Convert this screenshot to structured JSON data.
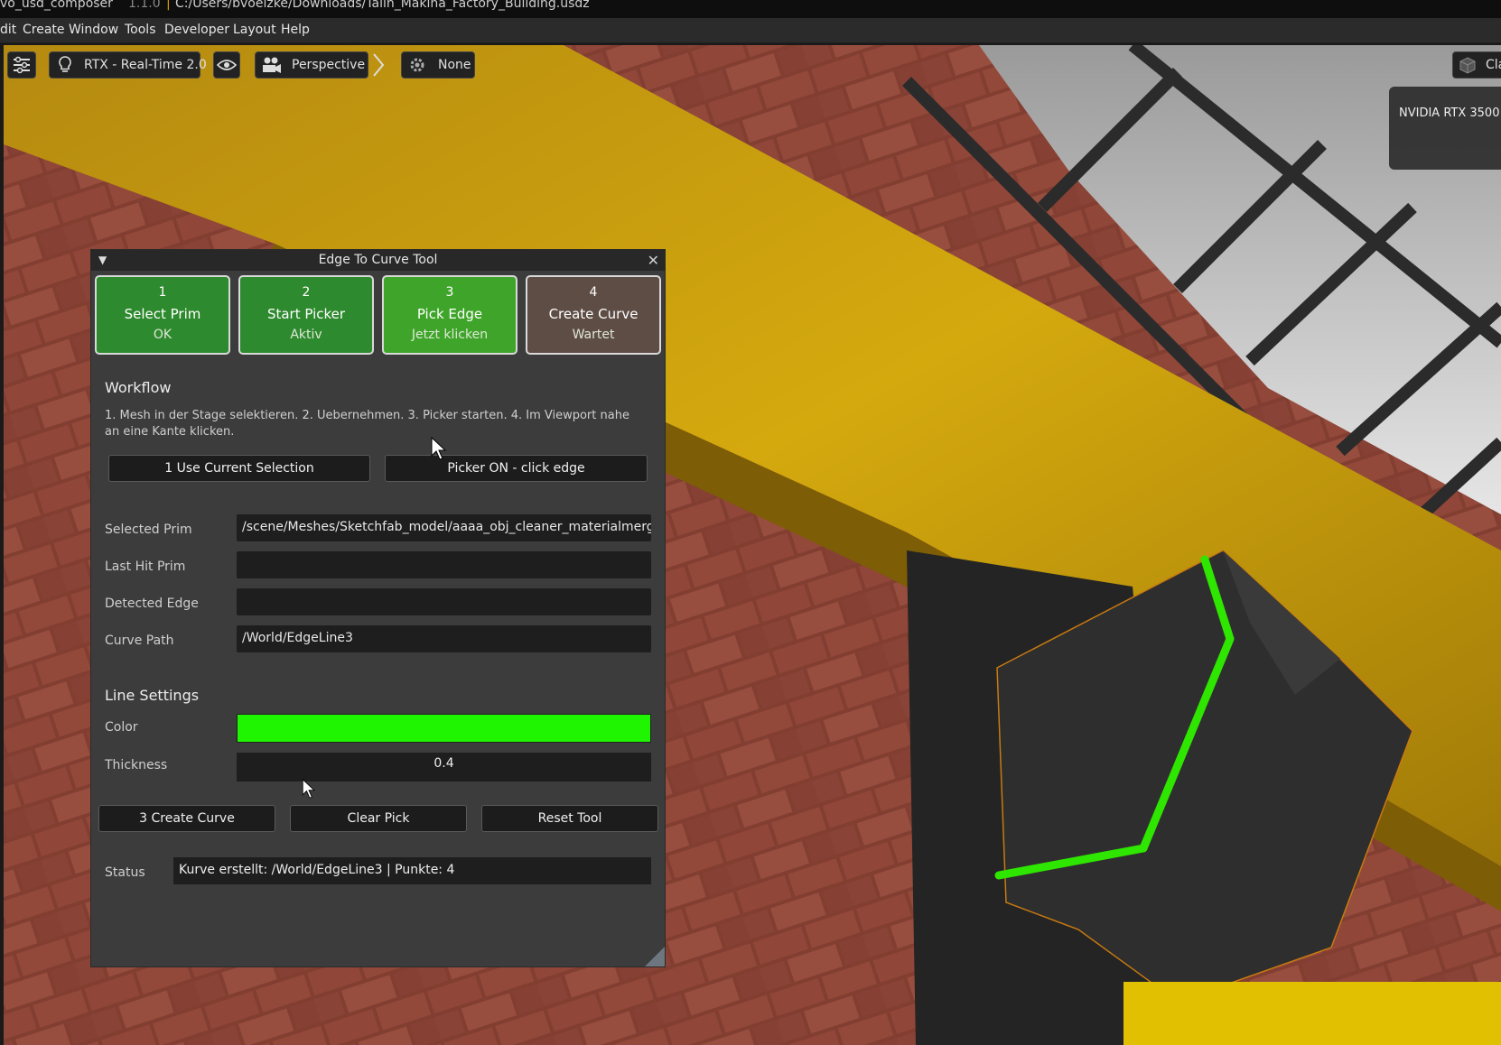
{
  "window_title": {
    "app": "vo_usd_composer",
    "version": "1.1.0",
    "separator": "|",
    "path": "C:/Users/bvoelzke/Downloads/Talin_Makina_Factory_Building.usdz"
  },
  "menu": [
    "dit",
    "Create",
    "Window",
    "Tools",
    "Developer",
    "Layout",
    "Help"
  ],
  "viewport_toolbar": {
    "renderer": "RTX - Real-Time 2.0",
    "camera": "Perspective",
    "settings_value": "None",
    "right_button": "Cla"
  },
  "gpu_label": "NVIDIA RTX 3500",
  "tool": {
    "title": "Edge To Curve Tool",
    "steps": [
      {
        "num": "1",
        "title": "Select Prim",
        "state": "OK",
        "color": "#2e8a2e"
      },
      {
        "num": "2",
        "title": "Start Picker",
        "state": "Aktiv",
        "color": "#2e8a2e"
      },
      {
        "num": "3",
        "title": "Pick Edge",
        "state": "Jetzt klicken",
        "color": "#3fa52a"
      },
      {
        "num": "4",
        "title": "Create Curve",
        "state": "Wartet",
        "color": "#5e4d45"
      }
    ],
    "workflow_heading": "Workflow",
    "workflow_text": "1. Mesh in der Stage selektieren. 2. Uebernehmen. 3. Picker starten. 4. Im Viewport nahe an eine Kante klicken.",
    "use_selection_button": "1  Use Current Selection",
    "picker_button": "Picker ON - click edge",
    "fields": {
      "selected_prim_label": "Selected Prim",
      "selected_prim_value": "/scene/Meshes/Sketchfab_model/aaaa_obj_cleaner_materialmerger_g",
      "last_hit_label": "Last Hit Prim",
      "last_hit_value": "",
      "detected_edge_label": "Detected Edge",
      "detected_edge_value": "",
      "curve_path_label": "Curve Path",
      "curve_path_value": "/World/EdgeLine3"
    },
    "line_settings_heading": "Line Settings",
    "color_label": "Color",
    "color_value": "#1ff500",
    "thickness_label": "Thickness",
    "thickness_value": "0.4",
    "create_curve_button": "3  Create Curve",
    "clear_pick_button": "Clear Pick",
    "reset_tool_button": "Reset Tool",
    "status_label": "Status",
    "status_value": "Kurve erstellt: /World/EdgeLine3 | Punkte: 4"
  },
  "icons": [
    "settings-sliders-icon",
    "lightbulb-icon",
    "eye-icon",
    "camera-icon",
    "chevron-right-icon",
    "gear-icon",
    "cube-icon",
    "collapse-triangle-icon",
    "close-icon",
    "mouse-cursor-icon"
  ]
}
